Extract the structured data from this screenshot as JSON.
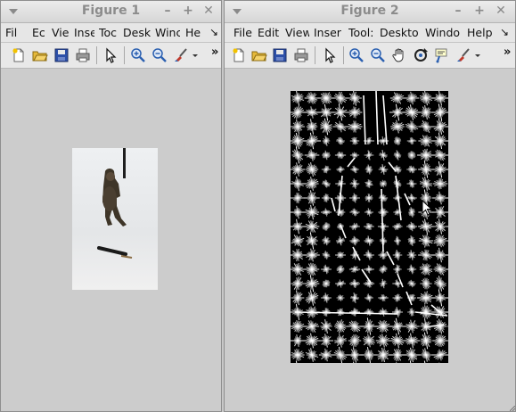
{
  "figure1": {
    "title": "Figure 1",
    "menu": [
      "Fil",
      "Ec",
      "Vie",
      "Inse",
      "Toc",
      "Desk",
      "Winc",
      "He"
    ],
    "more_menus": "↘",
    "more_tools": "»"
  },
  "figure2": {
    "title": "Figure 2",
    "menu": [
      "File",
      "Edit",
      "View",
      "Inser",
      "Tool:",
      "Deskto",
      "Windo",
      "Help"
    ],
    "more_menus": "↘",
    "more_tools": "»"
  },
  "window_controls": {
    "minimize": "–",
    "maximize": "+",
    "close": "✕"
  },
  "colors": {
    "title_text": "#8c8c8c",
    "hog_background": "#000000",
    "hog_stroke": "#ffffff",
    "figure_background": "#cccccc"
  },
  "icons": [
    "new-figure-icon",
    "open-file-icon",
    "save-icon",
    "print-icon",
    "pointer-icon",
    "zoom-in-icon",
    "zoom-out-icon",
    "pan-icon",
    "rotate-3d-icon",
    "data-cursor-icon",
    "brush-icon",
    "dropdown-arrow-icon"
  ]
}
